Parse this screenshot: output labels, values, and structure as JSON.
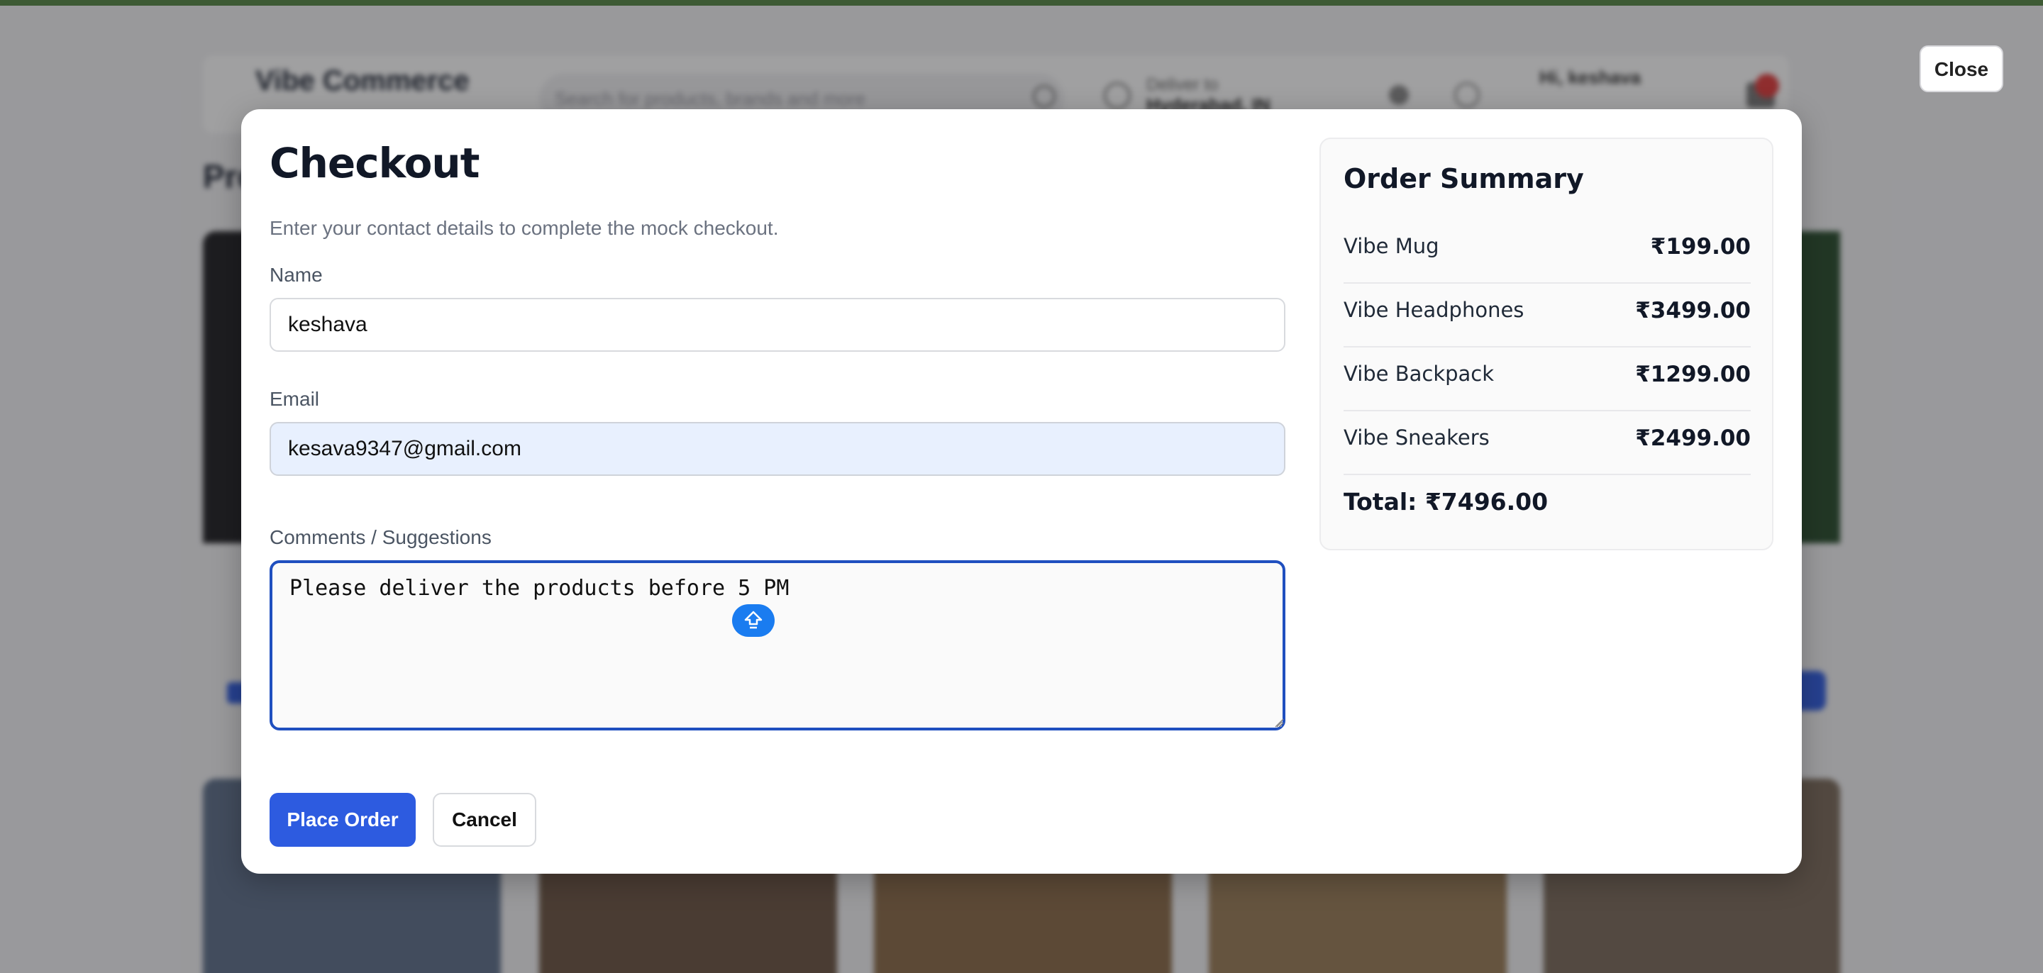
{
  "background": {
    "brand": "Vibe Commerce",
    "search_placeholder": "Search for products, brands and more",
    "deliver_label": "Deliver to",
    "deliver_location": "Hyderabad, IN",
    "greeting": "Hi, keshava",
    "section_title": "Products",
    "close_label": "Close"
  },
  "modal": {
    "title": "Checkout",
    "subtitle": "Enter your contact details to complete the mock checkout.",
    "name_label": "Name",
    "name_value": "keshava",
    "email_label": "Email",
    "email_value": "kesava9347@gmail.com",
    "comments_label": "Comments / Suggestions",
    "comments_value": "Please deliver the products before 5 PM",
    "place_order_label": "Place Order",
    "cancel_label": "Cancel"
  },
  "summary": {
    "title": "Order Summary",
    "items": [
      {
        "name": "Vibe Mug",
        "price": "₹199.00"
      },
      {
        "name": "Vibe Headphones",
        "price": "₹3499.00"
      },
      {
        "name": "Vibe Backpack",
        "price": "₹1299.00"
      },
      {
        "name": "Vibe Sneakers",
        "price": "₹2499.00"
      }
    ],
    "total": "Total: ₹7496.00"
  },
  "colors": {
    "primary": "#2d5be0",
    "focus_border": "#1f4fbf",
    "autofill_bg": "#e8f0fe",
    "cursor_badge": "#1a7cf0"
  }
}
